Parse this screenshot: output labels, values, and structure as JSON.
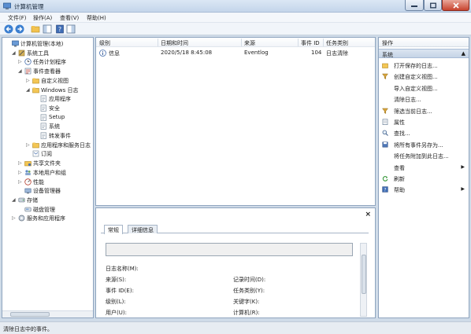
{
  "window": {
    "title": "计算机管理"
  },
  "menu": [
    "文件(F)",
    "操作(A)",
    "查看(V)",
    "帮助(H)"
  ],
  "tree": [
    {
      "label": "计算机管理(本地)",
      "level": 0,
      "expander": "",
      "icon": "computer-icon"
    },
    {
      "label": "系统工具",
      "level": 1,
      "expander": "◢",
      "icon": "tools-icon"
    },
    {
      "label": "任务计划程序",
      "level": 2,
      "expander": "▷",
      "icon": "clock-icon"
    },
    {
      "label": "事件查看器",
      "level": 2,
      "expander": "◢",
      "icon": "event-viewer-icon"
    },
    {
      "label": "自定义视图",
      "level": 3,
      "expander": "▷",
      "icon": "folder-icon"
    },
    {
      "label": "Windows 日志",
      "level": 3,
      "expander": "◢",
      "icon": "folder-icon"
    },
    {
      "label": "应用程序",
      "level": 4,
      "expander": "",
      "icon": "log-icon"
    },
    {
      "label": "安全",
      "level": 4,
      "expander": "",
      "icon": "log-icon"
    },
    {
      "label": "Setup",
      "level": 4,
      "expander": "",
      "icon": "log-icon"
    },
    {
      "label": "系统",
      "level": 4,
      "expander": "",
      "icon": "log-icon"
    },
    {
      "label": "转发事件",
      "level": 4,
      "expander": "",
      "icon": "log-icon"
    },
    {
      "label": "应用程序和服务日志",
      "level": 3,
      "expander": "▷",
      "icon": "folder-icon"
    },
    {
      "label": "订阅",
      "level": 3,
      "expander": "",
      "icon": "subscription-icon"
    },
    {
      "label": "共享文件夹",
      "level": 2,
      "expander": "▷",
      "icon": "shared-folder-icon"
    },
    {
      "label": "本地用户和组",
      "level": 2,
      "expander": "▷",
      "icon": "users-icon"
    },
    {
      "label": "性能",
      "level": 2,
      "expander": "▷",
      "icon": "performance-icon"
    },
    {
      "label": "设备管理器",
      "level": 2,
      "expander": "",
      "icon": "device-manager-icon"
    },
    {
      "label": "存储",
      "level": 1,
      "expander": "◢",
      "icon": "storage-icon"
    },
    {
      "label": "磁盘管理",
      "level": 2,
      "expander": "",
      "icon": "disk-icon"
    },
    {
      "label": "服务和应用程序",
      "level": 1,
      "expander": "▷",
      "icon": "services-icon"
    }
  ],
  "list": {
    "columns": [
      "级别",
      "日期和时间",
      "来源",
      "事件 ID",
      "任务类别"
    ],
    "rows": [
      {
        "level": "信息",
        "datetime": "2020/5/18 8:45:08",
        "source": "Eventlog",
        "event_id": "104",
        "task": "日志清除"
      }
    ]
  },
  "details": {
    "tabs": [
      "常规",
      "详细信息"
    ],
    "fields_left": [
      "日志名称(M):",
      "来源(S):",
      "事件 ID(E):",
      "级别(L):",
      "用户(U):"
    ],
    "fields_right": [
      "记录时间(D):",
      "任务类别(Y):",
      "关键字(K):",
      "计算机(R):"
    ]
  },
  "actions": {
    "header": "操作",
    "section": "系统",
    "items": [
      {
        "label": "打开保存的日志...",
        "icon": "open-log-icon",
        "submenu": false
      },
      {
        "label": "创建自定义视图...",
        "icon": "filter-icon",
        "submenu": false
      },
      {
        "label": "导入自定义视图...",
        "icon": "",
        "submenu": false
      },
      {
        "label": "清除日志...",
        "icon": "",
        "submenu": false
      },
      {
        "label": "筛选当前日志...",
        "icon": "filter-icon",
        "submenu": false
      },
      {
        "label": "属性",
        "icon": "properties-icon",
        "submenu": false
      },
      {
        "label": "查找...",
        "icon": "find-icon",
        "submenu": false
      },
      {
        "label": "将所有事件另存为...",
        "icon": "save-icon",
        "submenu": false
      },
      {
        "label": "将任务附加到此日志...",
        "icon": "",
        "submenu": false
      },
      {
        "label": "查看",
        "icon": "",
        "submenu": true
      },
      {
        "label": "刷新",
        "icon": "refresh-icon",
        "submenu": false
      },
      {
        "label": "帮助",
        "icon": "help-icon",
        "submenu": true
      }
    ]
  },
  "status": {
    "text": "清除日志中的事件。"
  }
}
